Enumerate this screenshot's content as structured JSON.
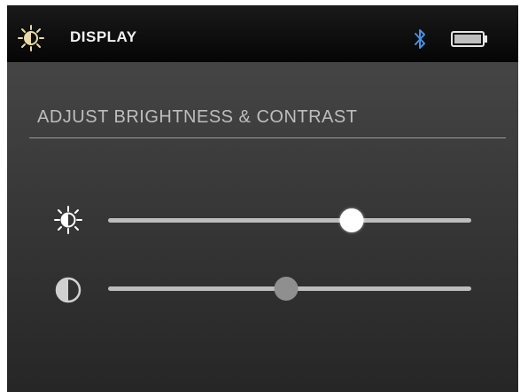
{
  "header": {
    "title": "DISPLAY",
    "icon": "brightness-icon",
    "status_icons": [
      "bluetooth-icon",
      "battery-icon"
    ]
  },
  "section": {
    "title": "ADJUST BRIGHTNESS & CONTRAST"
  },
  "sliders": [
    {
      "name": "brightness",
      "icon": "brightness-icon",
      "value": 0.67
    },
    {
      "name": "contrast",
      "icon": "contrast-icon",
      "value": 0.49
    }
  ],
  "colors": {
    "bluetooth": "#4a90e2",
    "thumb_active": "#ffffff",
    "thumb_inactive": "#8f8f8f",
    "track": "#bdbdbd"
  }
}
